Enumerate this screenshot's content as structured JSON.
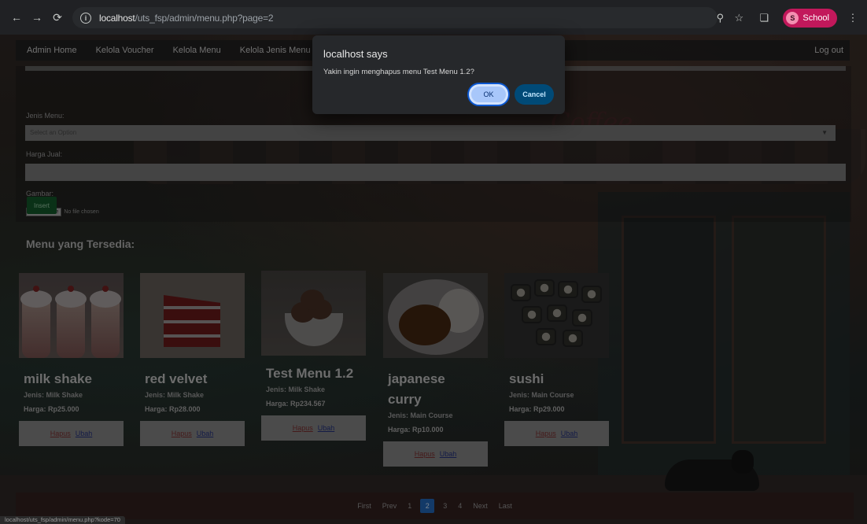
{
  "browser": {
    "url_host": "localhost",
    "url_path": "/uts_fsp/admin/menu.php?page=2",
    "profile_label": "School",
    "profile_initial": "S"
  },
  "navbar": {
    "items": [
      "Admin Home",
      "Kelola Voucher",
      "Kelola Menu",
      "Kelola Jenis Menu"
    ],
    "logout": "Log out"
  },
  "form": {
    "jenis_label": "Jenis Menu:",
    "select_placeholder": "Select an Option",
    "harga_label": "Harga Jual:",
    "gambar_label": "Gambar:",
    "file_button": "Choose File",
    "file_status": "No file chosen",
    "insert_label": "Insert"
  },
  "section_title": "Menu yang Tersedia:",
  "cards": [
    {
      "name": "milk shake",
      "jenis": "Jenis: Milk Shake",
      "harga": "Harga: Rp25.000",
      "hapus": "Hapus",
      "ubah": "Ubah"
    },
    {
      "name": "red velvet",
      "jenis": "Jenis: Milk Shake",
      "harga": "Harga: Rp28.000",
      "hapus": "Hapus",
      "ubah": "Ubah"
    },
    {
      "name": "Test Menu 1.2",
      "jenis": "Jenis: Milk Shake",
      "harga": "Harga: Rp234.567",
      "hapus": "Hapus",
      "ubah": "Ubah"
    },
    {
      "name": "japanese curry",
      "jenis": "Jenis: Main Course",
      "harga": "Harga: Rp10.000",
      "hapus": "Hapus",
      "ubah": "Ubah"
    },
    {
      "name": "sushi",
      "jenis": "Jenis: Main Course",
      "harga": "Harga: Rp29.000",
      "hapus": "Hapus",
      "ubah": "Ubah"
    }
  ],
  "pagination": {
    "first": "First",
    "prev": "Prev",
    "pages": [
      "1",
      "2",
      "3",
      "4"
    ],
    "active_page": "2",
    "next": "Next",
    "last": "Last"
  },
  "status_url": "localhost/uts_fsp/admin/menu.php?kode=70",
  "dialog": {
    "title": "localhost says",
    "message": "Yakin ingin menghapus menu Test Menu 1.2?",
    "ok": "OK",
    "cancel": "Cancel"
  },
  "colors": {
    "active_page": "#1f5ea8",
    "insert_button": "#115026",
    "ok_button": "#a8c7fa",
    "cancel_button": "#004a77"
  }
}
